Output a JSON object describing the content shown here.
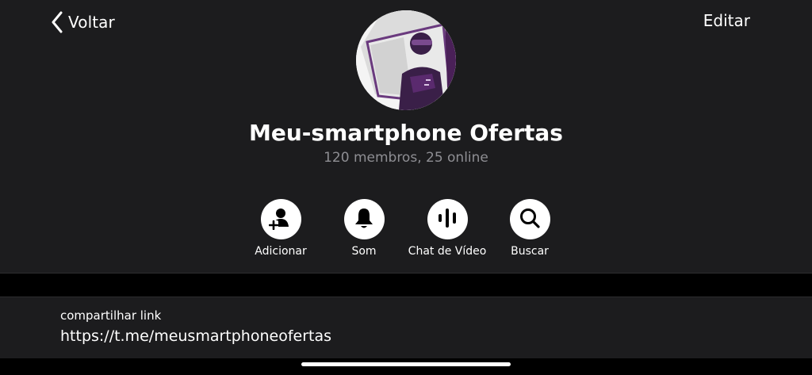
{
  "nav": {
    "back_label": "Voltar",
    "edit_label": "Editar"
  },
  "group": {
    "title": "Meu-smartphone Ofertas",
    "subtitle": "120 membros, 25 online",
    "avatar_icon": "group-avatar-purple-figure"
  },
  "actions": [
    {
      "label": "Adicionar",
      "icon": "add-member-icon"
    },
    {
      "label": "Som",
      "icon": "bell-icon"
    },
    {
      "label": "Chat de Vídeo",
      "icon": "voice-wave-icon"
    },
    {
      "label": "Buscar",
      "icon": "search-icon"
    }
  ],
  "share": {
    "caption": "compartilhar link",
    "url": "https://t.me/meusmartphoneofertas"
  },
  "colors": {
    "background": "#000000",
    "panel": "#1c1c1e",
    "subtitle": "#8e8e93",
    "avatar_accent": "#5a2a6e"
  }
}
